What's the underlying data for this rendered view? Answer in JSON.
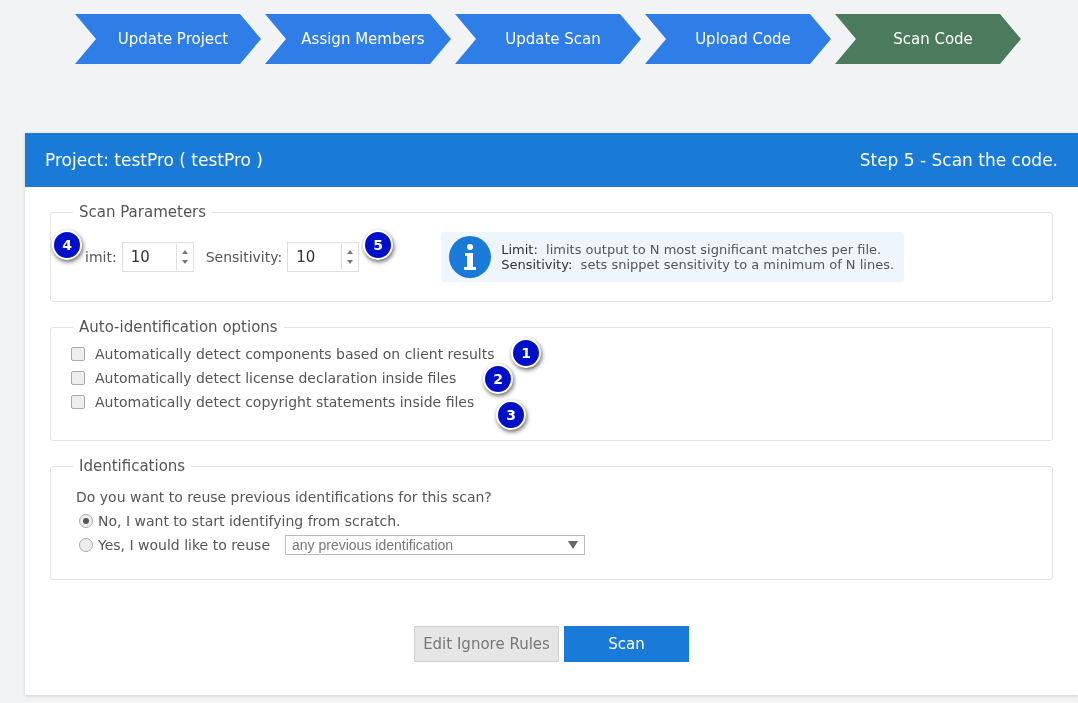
{
  "steps": [
    {
      "label": "Update Project",
      "selected": false
    },
    {
      "label": "Assign Members",
      "selected": false
    },
    {
      "label": "Update Scan",
      "selected": false
    },
    {
      "label": "Upload Code",
      "selected": false
    },
    {
      "label": "Scan Code",
      "selected": true
    }
  ],
  "panel": {
    "title": "Project: testPro ( testPro )",
    "step": "Step 5 - Scan the code."
  },
  "scan_parameters": {
    "legend": "Scan Parameters",
    "fields": [
      {
        "label": "imit:",
        "value": "10",
        "callout": "4"
      },
      {
        "label": "Sensitivity:",
        "value": "10",
        "callout": "5"
      }
    ],
    "info": [
      {
        "term": "Limit:",
        "text": "limits output to N most significant matches per file."
      },
      {
        "term": "Sensitivity:",
        "text": "sets snippet sensitivity to a minimum of N lines."
      }
    ]
  },
  "auto_identification": {
    "legend": "Auto-identification options",
    "options": [
      {
        "label": "Automatically detect components based on client results",
        "checked": false,
        "callout": "1"
      },
      {
        "label": "Automatically detect license declaration inside files",
        "checked": false,
        "callout": "2"
      },
      {
        "label": "Automatically detect copyright statements inside files",
        "checked": false,
        "callout": "3"
      }
    ]
  },
  "identifications": {
    "legend": "Identifications",
    "question": "Do you want to reuse previous identifications for this scan?",
    "choices": [
      {
        "label": "No, I want to start identifying from scratch.",
        "selected": true
      },
      {
        "label": "Yes, I would like to reuse",
        "selected": false
      }
    ],
    "select": {
      "value": "any previous identification"
    }
  },
  "buttons": [
    {
      "label": "Edit Ignore Rules",
      "kind": "secondary"
    },
    {
      "label": "Scan",
      "kind": "primary"
    }
  ]
}
